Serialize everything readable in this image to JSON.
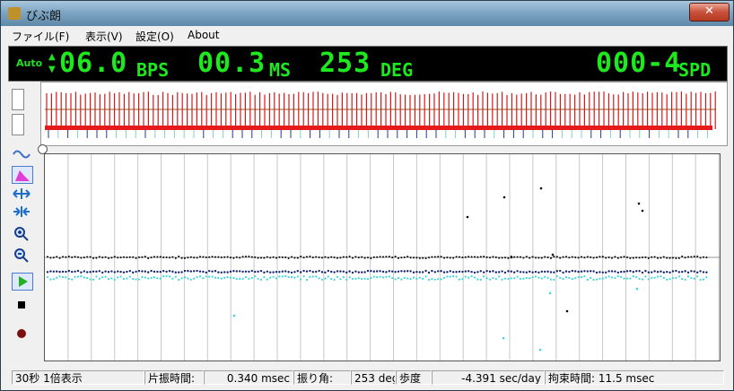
{
  "window": {
    "title": "びぶ朗",
    "close_glyph": "✕"
  },
  "menu": [
    {
      "label": "ファイル(F)"
    },
    {
      "label": "表示(V)"
    },
    {
      "label": "設定(O)"
    },
    {
      "label": "About"
    }
  ],
  "lcd": {
    "auto_label": "Auto",
    "beats_value": "06.0",
    "beats_unit": "BPS",
    "lift_time_value": "00.3",
    "lift_time_unit": "MS",
    "amplitude_value": "253",
    "amplitude_unit": "DEG",
    "rate_value": "000-4",
    "rate_unit": "SPD",
    "colors": {
      "digits": "#1ee81e",
      "background": "#000000"
    }
  },
  "status": {
    "mode": "30秒 1倍表示",
    "lift_time_label": "片振時間:",
    "lift_time_value": "0.340 msec",
    "amplitude_label": "振り角:",
    "amplitude_value": "253 deg",
    "rate_label": "歩度",
    "rate_value": "-4.391 sec/day",
    "lock_label": "拘束時間: 11.5 msec"
  },
  "toolbar_icons": [
    "sine-wave-icon",
    "histogram-icon",
    "expand-horizontal-icon",
    "shrink-horizontal-icon",
    "zoom-in-icon",
    "zoom-out-icon",
    "play-icon",
    "stop-icon",
    "record-icon"
  ]
}
